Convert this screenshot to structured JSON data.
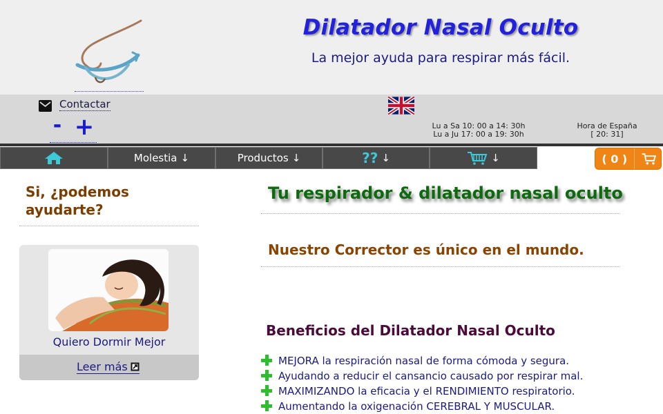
{
  "header": {
    "title": "Dilatador Nasal Oculto",
    "subtitle": "La mejor ayuda para respirar más fácil."
  },
  "infobar": {
    "contact_label": "Contactar",
    "zoom_minus": "-",
    "zoom_plus": "+",
    "hours_line1": "Lu a Sa 10: 00 a 14: 30h",
    "hours_line2": "Lu a Ju 17: 00 a 19: 30h",
    "spain_time_label": "Hora de España",
    "spain_time_value": "[ 20: 31]"
  },
  "nav": {
    "items": [
      {
        "icon": "home-icon"
      },
      {
        "label": "Molestia",
        "arrow": "↓"
      },
      {
        "label": "Productos",
        "arrow": "↓"
      },
      {
        "label": "??",
        "arrow": "↓"
      },
      {
        "icon": "cart-icon",
        "arrow": "↓"
      }
    ],
    "cart_count": "( 0 )"
  },
  "sidebar": {
    "title": "Si, ¿podemos ayudarte?",
    "card_caption": "Quiero Dormir Mejor",
    "read_more": "Leer más"
  },
  "main": {
    "heading": "Tu respirador & dilatador nasal oculto",
    "subheading": "Nuestro Corrector es único en el mundo.",
    "benefits_title": "Beneficios del Dilatador Nasal Oculto",
    "benefits": [
      "MEJORA la respiración nasal de forma cómoda y segura.",
      "Ayudando a reducir el cansancio causado por respirar mal.",
      "MAXIMIZANDO la eficacia y el RENDIMIENTO respiratorio.",
      "Aumentando la oxigenación CEREBRAL Y MUSCULAR."
    ]
  },
  "colors": {
    "title_blue": "#2222dd",
    "nav_bg": "#484848",
    "cart_orange": "#f08414",
    "heading_green": "#0e6a0e",
    "subheading_brown": "#8a4400",
    "benefit_plus": "#2ebd2e"
  }
}
